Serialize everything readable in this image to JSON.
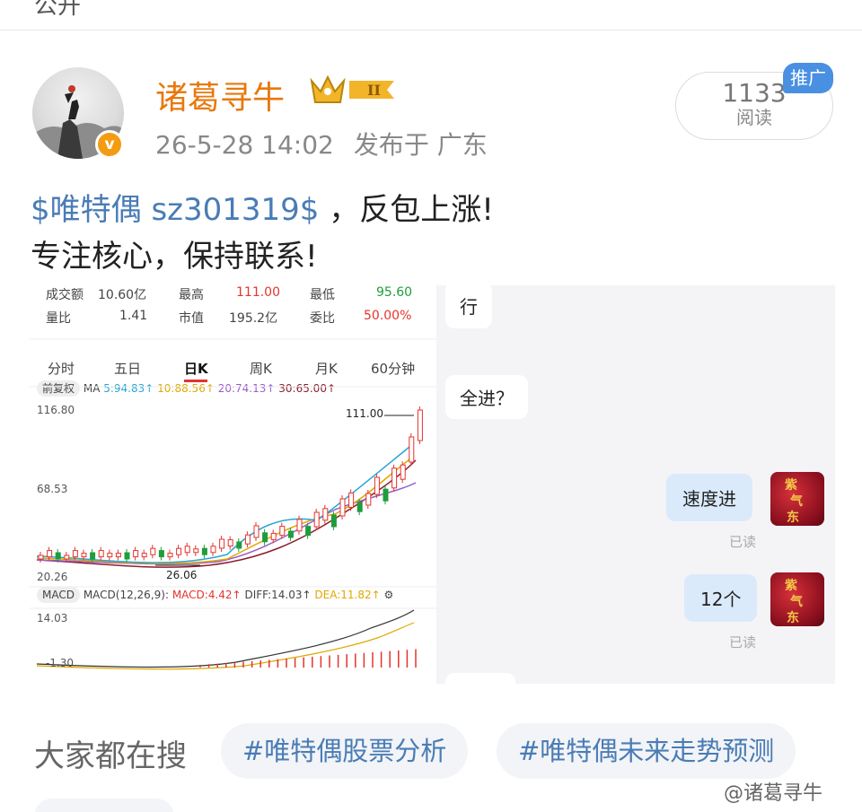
{
  "top": {
    "label": "公开"
  },
  "user": {
    "name": "诸葛寻牛",
    "level_badge": "II",
    "verified": "v",
    "time": "26-5-28 14:02",
    "location": "发布于 广东"
  },
  "reads": {
    "count": "1133",
    "label": "阅读",
    "promo": "推广"
  },
  "post": {
    "stock_tag": "$唯特偶 sz301319$",
    "line1_rest": "，反包上涨!",
    "line2": "专注核心，保持联系!"
  },
  "stock": {
    "turnover_label": "成交额",
    "turnover": "10.60亿",
    "high_label": "最高",
    "high": "111.00",
    "low_label": "最低",
    "low": "95.60",
    "vol_ratio_label": "量比",
    "vol_ratio": "1.41",
    "mktcap_label": "市值",
    "mktcap": "195.2亿",
    "bid_ratio_label": "委比",
    "bid_ratio": "50.00%",
    "tabs": [
      "分时",
      "五日",
      "日K",
      "周K",
      "月K",
      "60分钟"
    ],
    "ma_adjust": "前复权",
    "ma_label": "MA",
    "ma5": "5:94.83↑",
    "ma10": "10:88.56↑",
    "ma20": "20:74.13↑",
    "ma30": "30:65.00↑",
    "y_top": "116.80",
    "y_mid": "68.53",
    "y_low": "20.26",
    "peak_label": "111.00",
    "trough_label": "26.06",
    "macd_tab": "MACD",
    "macd_params": "MACD(12,26,9):",
    "macd_val": "MACD:4.42↑",
    "diff_val": "DIFF:14.03↑",
    "dea_val": "DEA:11.82↑",
    "macd_top": "14.03",
    "macd_low": "-1.30"
  },
  "chat": {
    "msg1": "行",
    "msg2": "全进？",
    "msg3": "速度进",
    "msg4": "12个",
    "read_mark": "已读",
    "avatar_text": "紫气东来"
  },
  "search": {
    "label": "大家都在搜",
    "chips": [
      "#唯特偶股票分析",
      "#唯特偶未来走势预测"
    ]
  },
  "watermark": "@诸葛寻牛",
  "colors": {
    "username": "#e8780c",
    "tag": "#4a7cb5",
    "up": "#e4342c",
    "down": "#1f9d3a"
  }
}
